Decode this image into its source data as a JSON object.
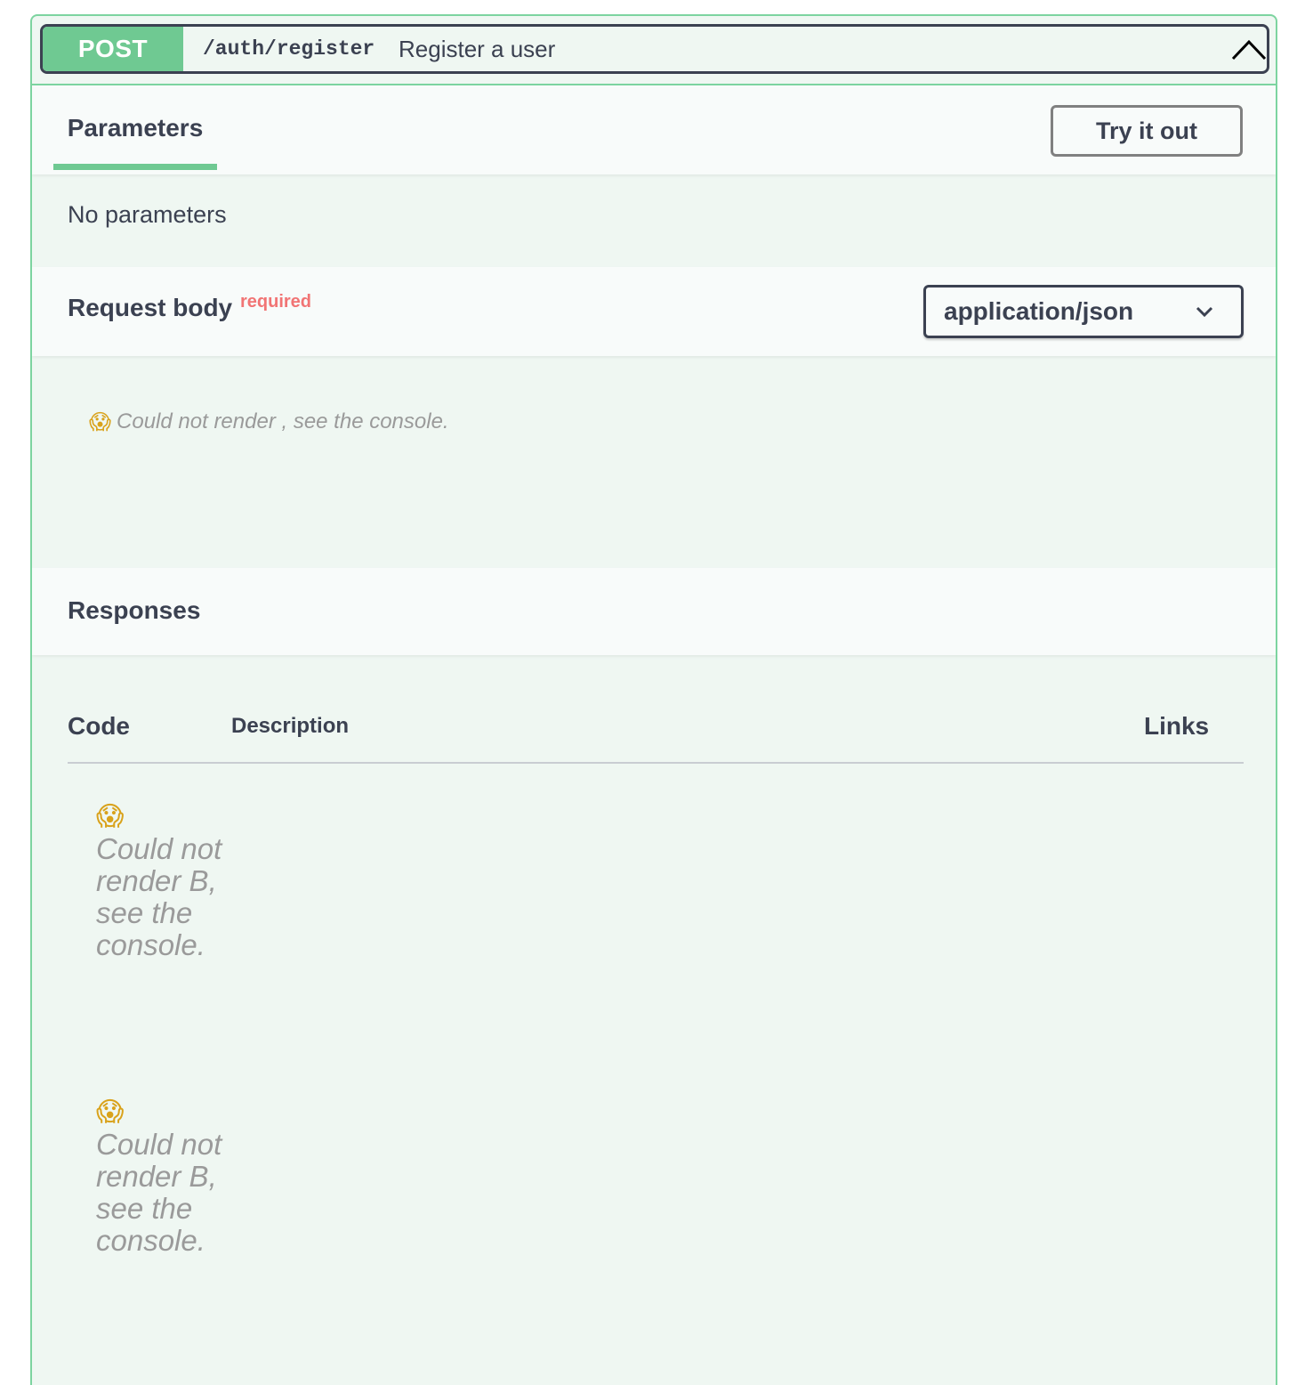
{
  "endpoint": {
    "method": "POST",
    "path": "/auth/register",
    "summary": "Register a user",
    "colors": {
      "method_bg": "#6fc992",
      "border": "#7dd4a0",
      "required": "#f17474"
    }
  },
  "parameters": {
    "tab_label": "Parameters",
    "try_button": "Try it out",
    "empty_text": "No parameters"
  },
  "request_body": {
    "title": "Request body",
    "required_label": "required",
    "content_type": "application/json",
    "error_text": "Could not render , see the console."
  },
  "responses": {
    "title": "Responses",
    "columns": {
      "code": "Code",
      "description": "Description",
      "links": "Links"
    },
    "rows": [
      {
        "error_text": "Could not render B, see the console."
      },
      {
        "error_text": "Could not render B, see the console."
      }
    ]
  },
  "icons": {
    "collapse": "chevron-up-icon",
    "select": "chevron-down-icon",
    "error": "scream-emoji-icon",
    "error_glyph": "😱"
  }
}
